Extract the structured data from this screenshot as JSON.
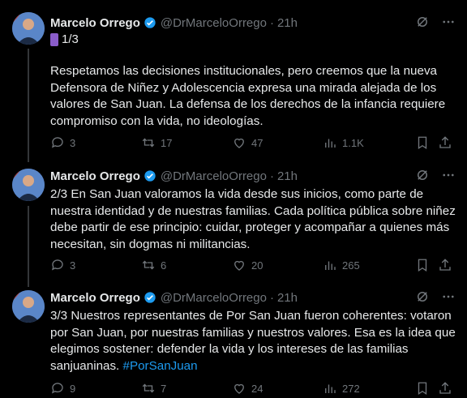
{
  "tweets": [
    {
      "name": "Marcelo Orrego",
      "handle": "@DrMarceloOrrego",
      "time": "21h",
      "thread_marker": "1/3",
      "text": "Respetamos las decisiones institucionales, pero creemos que la nueva Defensora de Niñez y Adolescencia expresa una mirada alejada de los valores de San Juan. La defensa de los derechos de la infancia requiere compromiso con la vida, no ideologías.",
      "replies": "3",
      "retweets": "17",
      "likes": "47",
      "views": "1.1K"
    },
    {
      "name": "Marcelo Orrego",
      "handle": "@DrMarceloOrrego",
      "time": "21h",
      "text": "2/3 En San Juan valoramos la vida desde sus inicios, como parte de nuestra identidad y de nuestras familias. Cada política pública sobre niñez debe partir de ese principio: cuidar, proteger y acompañar a quienes más necesitan, sin dogmas ni militancias.",
      "replies": "3",
      "retweets": "6",
      "likes": "20",
      "views": "265"
    },
    {
      "name": "Marcelo Orrego",
      "handle": "@DrMarceloOrrego",
      "time": "21h",
      "text": "3/3 Nuestros representantes de Por San Juan fueron coherentes: votaron por San Juan, por nuestras familias y nuestros valores. Esa es la idea que elegimos sostener: defender la vida y los intereses de las familias sanjuaninas.",
      "hashtag": "#PorSanJuan",
      "replies": "9",
      "retweets": "7",
      "likes": "24",
      "views": "272"
    }
  ],
  "icons": [
    "verified-badge-icon",
    "grok-icon",
    "more-icon",
    "reply-icon",
    "retweet-icon",
    "like-icon",
    "views-icon",
    "bookmark-icon",
    "share-icon"
  ],
  "colors": {
    "background": "#000000",
    "text": "#e7e9ea",
    "muted": "#71767b",
    "accent": "#1d9bf0"
  }
}
